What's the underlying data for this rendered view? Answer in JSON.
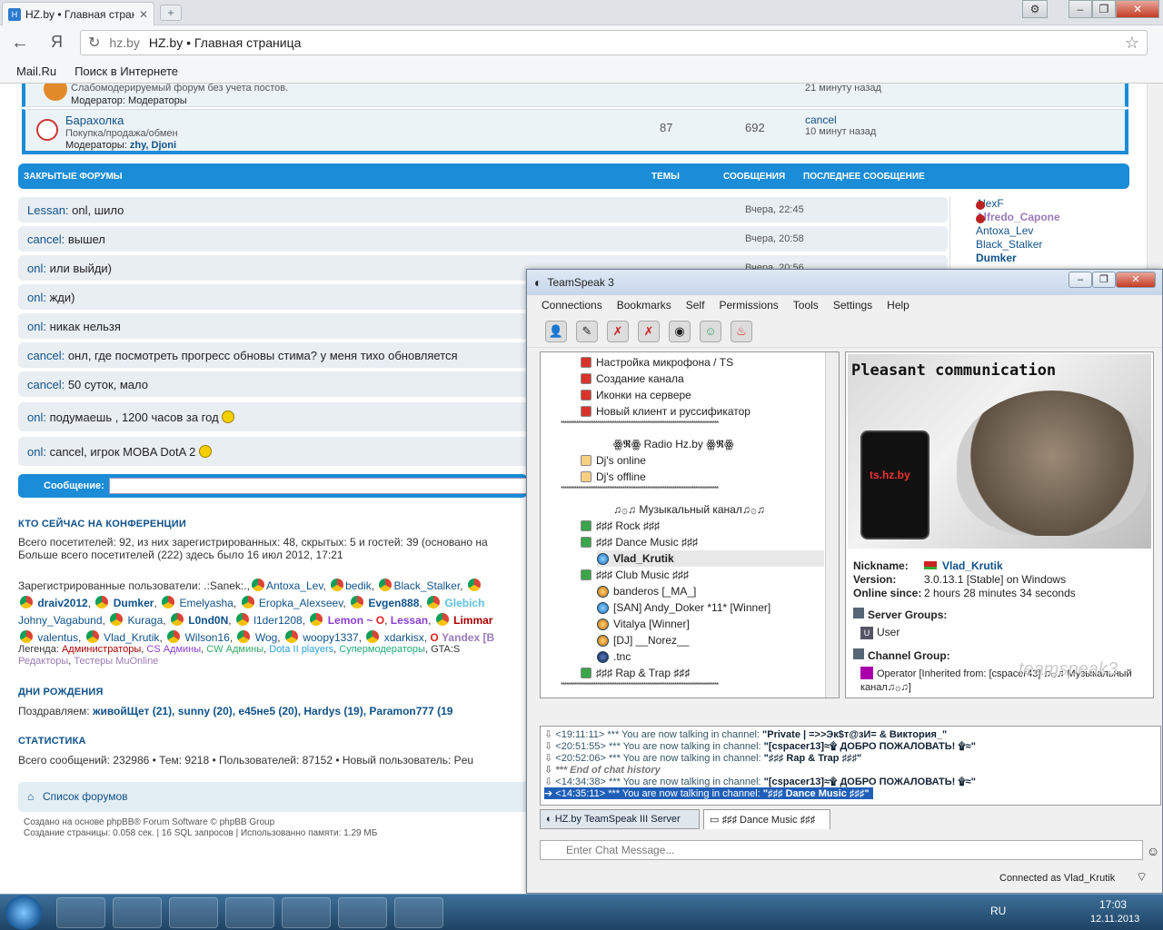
{
  "browser": {
    "tab_title": "HZ.by • Главная стран",
    "new_tab": "+",
    "url_host": "hz.by",
    "url_title": "HZ.by • Главная страница",
    "bookmarks": [
      "Mail.Ru",
      "Поиск в Интернете"
    ],
    "yandex_glyph": "Я"
  },
  "forum": {
    "top_row": {
      "desc": "Слабомодерируемый форум без учета постов.",
      "mods": "Модератор: Модераторы",
      "last": "21 минуту назад"
    },
    "baraholka": {
      "title": "Барахолка",
      "desc": "Покупка/продажа/обмен",
      "mods_label": "Модераторы:",
      "mods": "zhy, Djoni",
      "topics": "87",
      "posts": "692",
      "last_user": "cancel",
      "last_time": "10 минут назад"
    },
    "closed_header": {
      "title": "ЗАКРЫТЫЕ ФОРУМЫ",
      "col_topics": "ТЕМЫ",
      "col_posts": "СООБЩЕНИЯ",
      "col_last": "ПОСЛЕДНЕЕ СООБЩЕНИЕ"
    },
    "chat": [
      {
        "user": "Lessan:",
        "text": "onl, шило",
        "time": "Вчера, 22:45"
      },
      {
        "user": "cancel:",
        "text": "вышел",
        "time": "Вчера, 20:58"
      },
      {
        "user": "onl:",
        "text": "или выйди)",
        "time": "Вчера, 20:56"
      },
      {
        "user": "onl:",
        "text": "жди)",
        "time": ""
      },
      {
        "user": "onl:",
        "text": "никак нельзя",
        "time": ""
      },
      {
        "user": "cancel:",
        "text": "онл, где посмотреть прогресс обновы стима? у меня тихо обновляется",
        "time": ""
      },
      {
        "user": "cancel:",
        "text": "50 суток, мало",
        "time": ""
      },
      {
        "user": "onl:",
        "text": "подумаешь , 1200 часов за год",
        "time": ""
      },
      {
        "user": "onl:",
        "text": "cancel, игрок MOBA DotA 2",
        "time": ""
      }
    ],
    "message_label": "Сообщение:",
    "online_list": [
      "AlexF",
      "Alfredo_Capone",
      "Antoxa_Lev",
      "Black_Stalker",
      "Dumker"
    ],
    "who_online": {
      "heading": "КТО СЕЙЧАС НА КОНФЕРЕНЦИИ",
      "line1": "Всего посетителей: 92, из них зарегистрированных: 48, скрытых: 5 и гостей: 39 (основано на",
      "line2": "Больше всего посетителей (222) здесь было 16 июл 2012, 17:21",
      "reg_label": "Зарегистрированные пользователи: .:Sanek:.,",
      "users_row1": [
        "Antoxa_Lev",
        "bedik",
        "Black_Stalker"
      ],
      "users_row2": [
        "draiv2012",
        "Dumker",
        "Emelyasha",
        "Eropka_Alexseev",
        "Evgen888",
        "Glebich"
      ],
      "users_row3": [
        "Johny_Vagabund",
        "Kuraga",
        "L0nd0N",
        "l1der1208",
        "Lemon ~",
        "Lessan",
        "Limmar"
      ],
      "users_row4": [
        "valentus",
        "Vlad_Krutik",
        "Wilson16",
        "Wog",
        "woopy1337",
        "xdarkisx",
        "Yandex [B"
      ],
      "legend_label": "Легенда:",
      "legend": [
        "Администраторы",
        "CS Админы",
        "CW Админы",
        "Dota II players",
        "Супермодераторы",
        "GTA:S"
      ],
      "legend2": [
        "Редакторы",
        "Тестеры MuOnline"
      ]
    },
    "birthdays": {
      "heading": "ДНИ РОЖДЕНИЯ",
      "label": "Поздравляем:",
      "text": "живойЩет (21), sunny (20), e45не5 (20), Hardys (19), Paramon777 (19"
    },
    "stats": {
      "heading": "СТАТИСТИКА",
      "text": "Всего сообщений: 232986 • Тем: 9218 • Пользователей: 87152 • Новый пользователь: Peu"
    },
    "footer_link": "Список форумов",
    "footer1": "Создано на основе phpBB® Forum Software © phpBB Group",
    "footer2": "Создание страницы: 0.058 сек. | 16 SQL запросов | Использованно памяти: 1.29 МБ"
  },
  "ts": {
    "title": "TeamSpeak 3",
    "menu": [
      "Connections",
      "Bookmarks",
      "Self",
      "Permissions",
      "Tools",
      "Settings",
      "Help"
    ],
    "tree": [
      {
        "kind": "ch",
        "text": "Настройка микрофона / TS"
      },
      {
        "kind": "ch",
        "text": "Создание канала"
      },
      {
        "kind": "ch",
        "text": "Иконки на сервере"
      },
      {
        "kind": "ch",
        "text": "Новый клиент и руссификатор"
      },
      {
        "kind": "spacer",
        "text": "**********************************************************************************"
      },
      {
        "kind": "group",
        "text": "ꙮ𝕽ꙮ Radio Hz.by ꙮ𝕽ꙮ"
      },
      {
        "kind": "ch",
        "text": "Dj's online"
      },
      {
        "kind": "ch",
        "text": "Dj's offline"
      },
      {
        "kind": "spacer",
        "text": "**********************************************************************************"
      },
      {
        "kind": "group",
        "text": "♫۞♫ Музыкальный канал♫۞♫"
      },
      {
        "kind": "ch",
        "text": "♯♯♯ Rock ♯♯♯"
      },
      {
        "kind": "ch",
        "text": "♯♯♯ Dance Music ♯♯♯"
      },
      {
        "kind": "user",
        "text": "Vlad_Krutik"
      },
      {
        "kind": "ch",
        "text": "♯♯♯ Club Music ♯♯♯"
      },
      {
        "kind": "user",
        "text": "banderos [_MA_]"
      },
      {
        "kind": "user",
        "text": "[SAN] Andy_Doker *11* [Winner]"
      },
      {
        "kind": "user",
        "text": "Vitalya [Winner]"
      },
      {
        "kind": "user",
        "text": "[DJ] __Norez__"
      },
      {
        "kind": "user",
        "text": ".tnc"
      },
      {
        "kind": "ch",
        "text": "♯♯♯ Rap & Trap ♯♯♯"
      },
      {
        "kind": "spacer",
        "text": "**********************************************************************************"
      }
    ],
    "banner_text": "Pleasant communication",
    "banner_phone": "ts.hz.by",
    "info": {
      "nickname_label": "Nickname:",
      "nickname": "Vlad_Krutik",
      "version_label": "Version:",
      "version": "3.0.13.1 [Stable] on Windows",
      "online_label": "Online since:",
      "online": "2 hours 28 minutes 34 seconds",
      "server_groups_label": "Server Groups:",
      "server_group": "User",
      "channel_group_label": "Channel Group:",
      "channel_group": "Operator [Inherited from: [cspacer43] ♫۞♫ Музыкальный канал♫۞♫]",
      "watermark": "teamspeak3"
    },
    "log": [
      {
        "time": "<19:11:11>",
        "msg": "*** You are now talking in channel:",
        "ch": "\"Private | =>>Эк$т@зИ= & Виктория_\""
      },
      {
        "time": "<20:51:55>",
        "msg": "*** You are now talking in channel:",
        "ch": "\"[cspacer13]≈۩ ДОБРО ПОЖАЛОВАТЬ! ۩≈\""
      },
      {
        "time": "<20:52:06>",
        "msg": "*** You are now talking in channel:",
        "ch": "\"♯♯♯ Rap & Trap ♯♯♯\""
      },
      {
        "time": "",
        "msg": "*** End of chat history",
        "ch": ""
      },
      {
        "time": "<14:34:38>",
        "msg": "*** You are now talking in channel:",
        "ch": "\"[cspacer13]≈۩ ДОБРО ПОЖАЛОВАТЬ! ۩≈\""
      },
      {
        "time": "<14:35:11>",
        "msg": "*** You are now talking in channel:",
        "ch": "\"♯♯♯ Dance Music ♯♯♯\""
      }
    ],
    "tab_server": "HZ.by TeamSpeak III Server",
    "tab_channel": "♯♯♯ Dance Music ♯♯♯",
    "chat_placeholder": "Enter Chat Message...",
    "status": "Connected as Vlad_Krutik"
  },
  "taskbar": {
    "lang": "RU",
    "time": "17:03",
    "date": "12.11.2013"
  }
}
